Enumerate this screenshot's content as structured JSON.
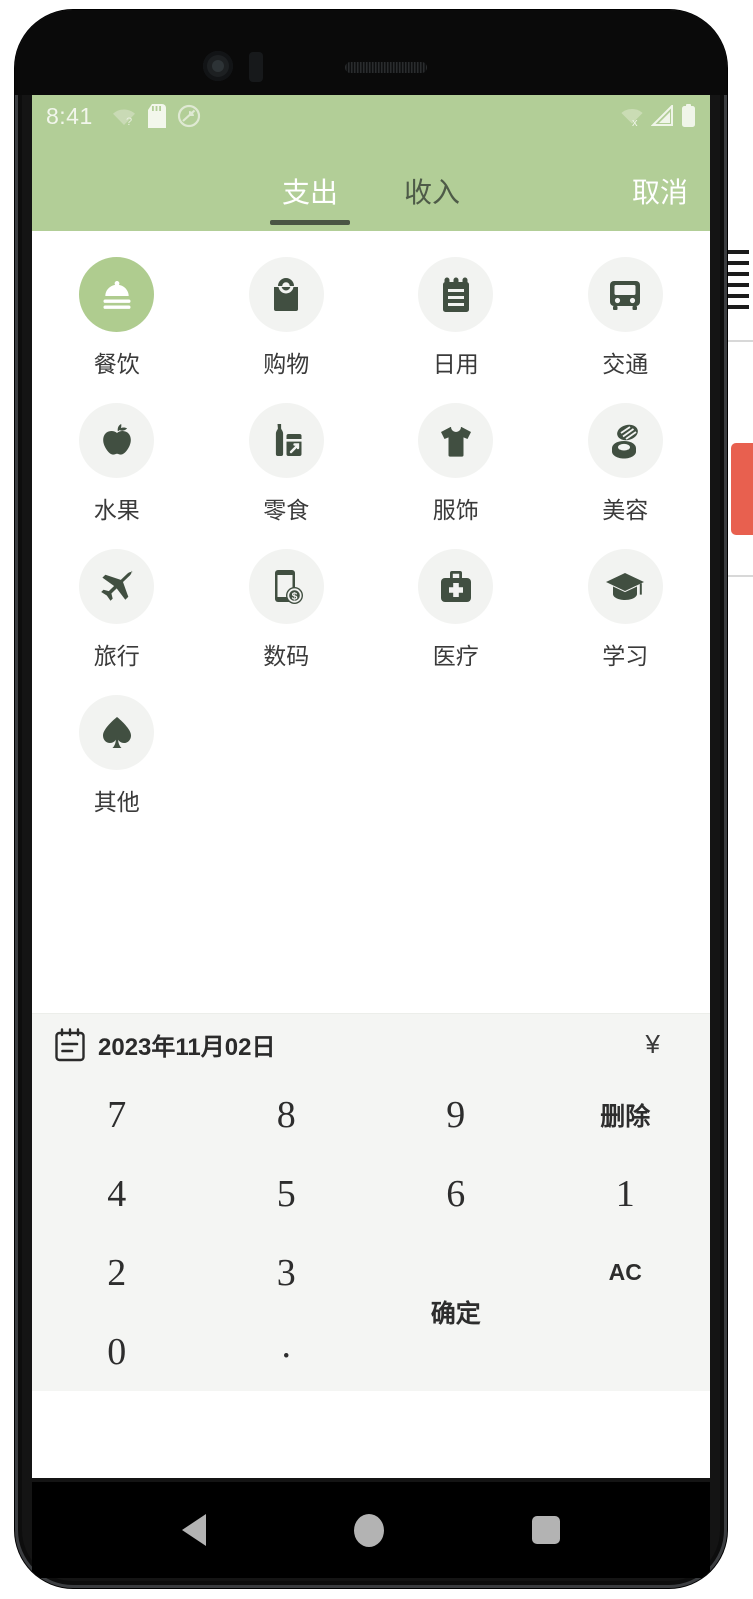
{
  "statusbar": {
    "time": "8:41",
    "left_icons": [
      "wifi-question-icon",
      "sd-card-icon",
      "dnd-icon"
    ],
    "right_icons": [
      "wifi-off-icon",
      "cell-signal-icon",
      "battery-icon"
    ]
  },
  "header": {
    "tabs": [
      {
        "label": "支出",
        "active": true
      },
      {
        "label": "收入",
        "active": false
      }
    ],
    "cancel_label": "取消",
    "bg_color": "#b2ce97",
    "active_tab_color": "#ffffff",
    "inactive_tab_color": "#4e5b48"
  },
  "categories": [
    {
      "label": "餐饮",
      "icon": "dining-cloche-icon",
      "selected": true
    },
    {
      "label": "购物",
      "icon": "shopping-bag-icon",
      "selected": false
    },
    {
      "label": "日用",
      "icon": "notepad-icon",
      "selected": false
    },
    {
      "label": "交通",
      "icon": "bus-icon",
      "selected": false
    },
    {
      "label": "水果",
      "icon": "apple-icon",
      "selected": false
    },
    {
      "label": "零食",
      "icon": "snacks-bottle-icon",
      "selected": false
    },
    {
      "label": "服饰",
      "icon": "tshirt-icon",
      "selected": false
    },
    {
      "label": "美容",
      "icon": "makeup-compact-icon",
      "selected": false
    },
    {
      "label": "旅行",
      "icon": "airplane-icon",
      "selected": false
    },
    {
      "label": "数码",
      "icon": "phone-dollar-icon",
      "selected": false
    },
    {
      "label": "医疗",
      "icon": "first-aid-kit-icon",
      "selected": false
    },
    {
      "label": "学习",
      "icon": "graduation-cap-icon",
      "selected": false
    },
    {
      "label": "其他",
      "icon": "spade-icon",
      "selected": false
    }
  ],
  "meta": {
    "date": "2023年11月02日",
    "date_icon": "calendar-icon",
    "currency": "¥"
  },
  "keypad": {
    "keys": [
      {
        "label": "7",
        "type": "digit"
      },
      {
        "label": "8",
        "type": "digit"
      },
      {
        "label": "9",
        "type": "digit"
      },
      {
        "label": "删除",
        "type": "word"
      },
      {
        "label": "4",
        "type": "digit"
      },
      {
        "label": "5",
        "type": "digit"
      },
      {
        "label": "6",
        "type": "digit"
      },
      {
        "label": "1",
        "type": "digit"
      },
      {
        "label": "2",
        "type": "digit"
      },
      {
        "label": "3",
        "type": "digit"
      },
      {
        "label": "确定",
        "type": "word-tall"
      },
      {
        "label": "AC",
        "type": "ac"
      },
      {
        "label": "0",
        "type": "digit"
      },
      {
        "label": ".",
        "type": "dot"
      }
    ]
  },
  "navbar": {
    "back": "back-triangle-icon",
    "home": "home-circle-icon",
    "recents": "recents-square-icon"
  },
  "colors": {
    "brand_green": "#b2ce97",
    "selected_circle": "#afcc8f",
    "icon_dark": "#414f41",
    "keypad_bg": "#f4f5f3"
  }
}
